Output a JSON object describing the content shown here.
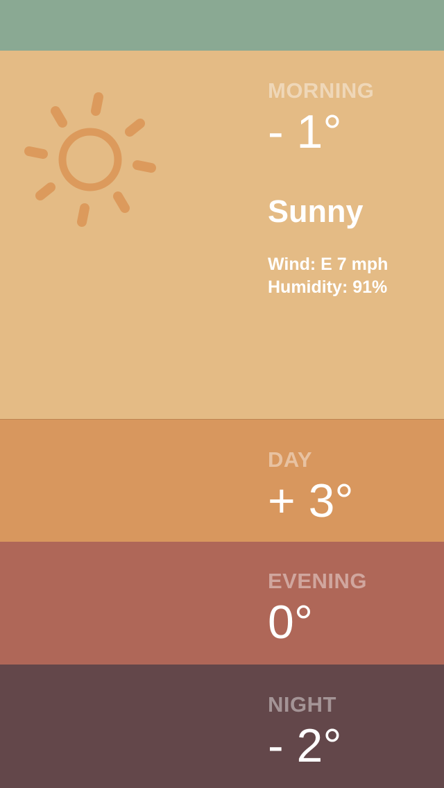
{
  "colors": {
    "topbar": "#8aa993",
    "morning": "#e4bb85",
    "day": "#d8975e",
    "evening": "#af6758",
    "night": "#63474a",
    "sun_icon": "#dc9a5c"
  },
  "morning": {
    "label": "MORNING",
    "temp": "- 1°",
    "condition": "Sunny",
    "icon": "sun-icon",
    "wind": "Wind: E 7 mph",
    "humidity": "Humidity: 91%"
  },
  "day": {
    "label": "DAY",
    "temp": "+ 3°"
  },
  "evening": {
    "label": "EVENING",
    "temp": "0°"
  },
  "night": {
    "label": "NIGHT",
    "temp": "- 2°"
  }
}
